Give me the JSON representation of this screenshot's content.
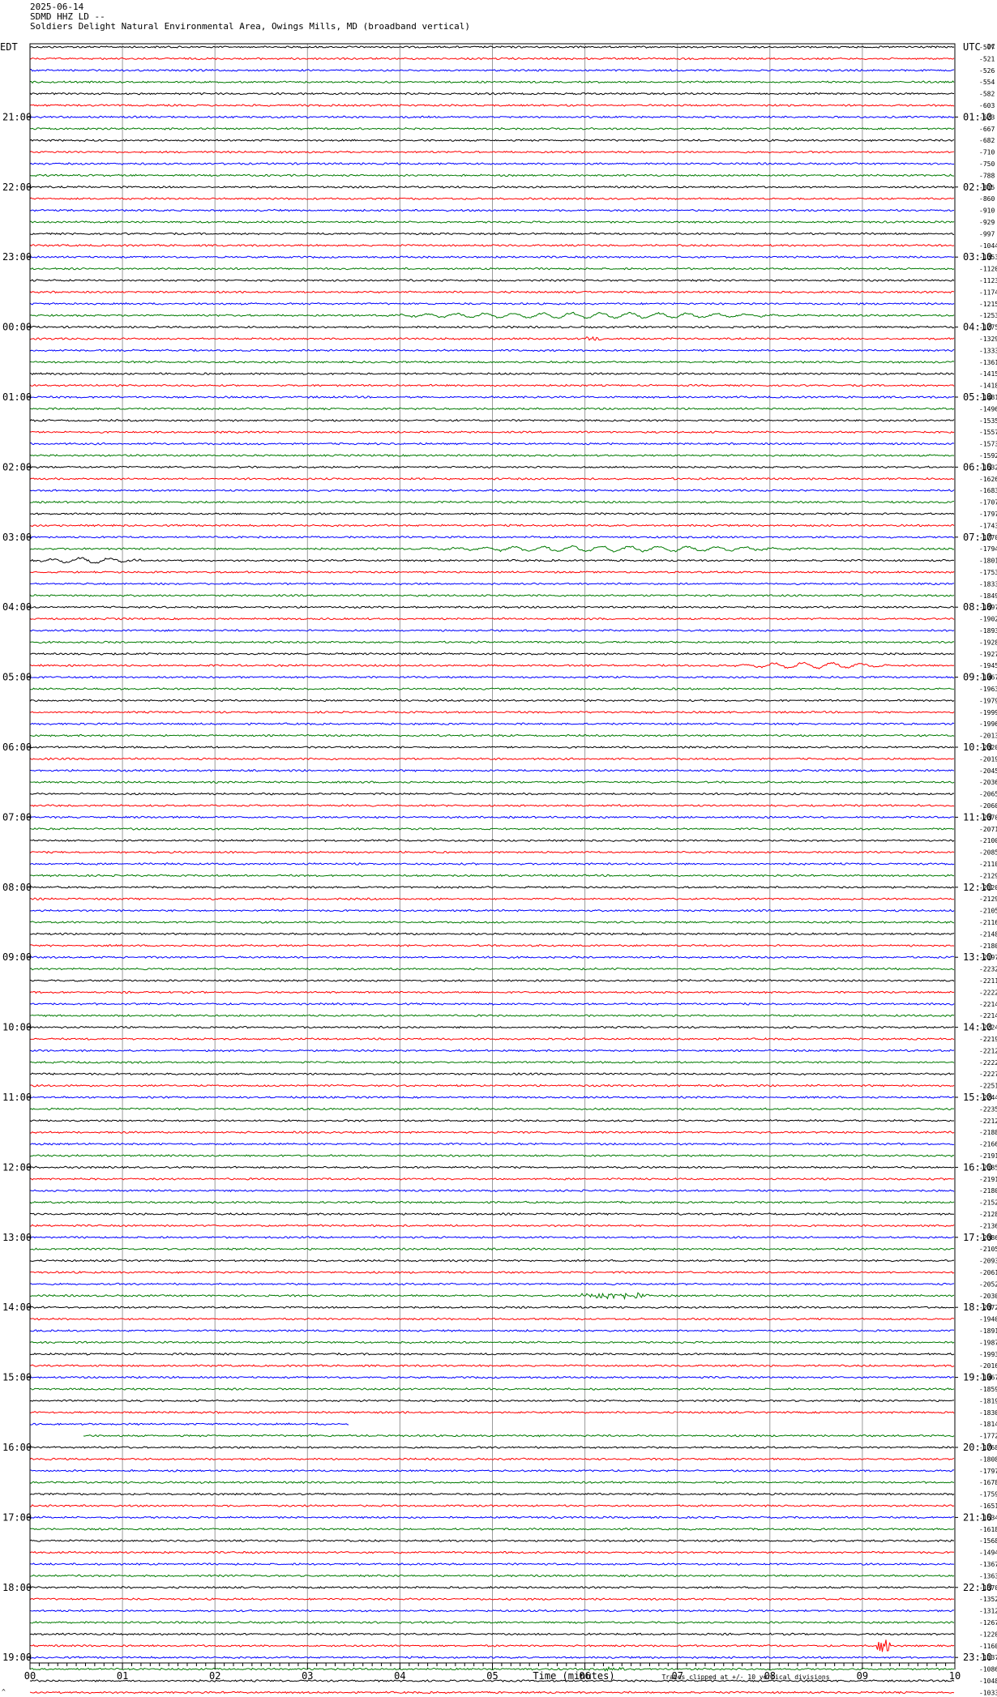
{
  "header": {
    "date": "2025-06-14",
    "station": "SDMD HHZ LD --",
    "location": "Soldiers Delight Natural Environmental Area, Owings Mills, MD (broadband vertical)"
  },
  "labels": {
    "left_tz": "EDT",
    "right_tz": "UTC",
    "dc": "DC",
    "footnote": "Traces clipped at +/- 10 vertical divisions",
    "corner": "^"
  },
  "chart_data": {
    "type": "line",
    "xlabel": "Time (minutes)",
    "x_ticks": [
      "00",
      "01",
      "02",
      "03",
      "04",
      "05",
      "06",
      "07",
      "08",
      "09",
      "10"
    ],
    "xlim": [
      0,
      10
    ],
    "grid": true,
    "trace_colors": [
      "#000000",
      "#ff0000",
      "#0000ff",
      "#007a00"
    ],
    "traces_per_hour": 6,
    "left_hour_labels": [
      "21:00",
      "22:00",
      "23:00",
      "00:00",
      "01:00",
      "02:00",
      "03:00",
      "04:00",
      "05:00",
      "06:00",
      "07:00",
      "08:00",
      "09:00",
      "10:00",
      "11:00",
      "12:00",
      "13:00",
      "14:00",
      "15:00",
      "16:00",
      "17:00",
      "18:00",
      "19:00"
    ],
    "right_hour_labels": [
      "01:10",
      "02:10",
      "03:10",
      "04:10",
      "05:10",
      "06:10",
      "07:10",
      "08:10",
      "09:10",
      "10:10",
      "11:10",
      "12:10",
      "13:10",
      "14:10",
      "15:10",
      "16:10",
      "17:10",
      "18:10",
      "19:10",
      "20:10",
      "21:10",
      "22:10",
      "23:10"
    ],
    "first_hour_label_row": 6,
    "dc_offsets": [
      "-507",
      "-521",
      "-526",
      "-554",
      "-582",
      "-603",
      "-623",
      "-667",
      "-682",
      "-710",
      "-750",
      "-788",
      "-815",
      "-860",
      "-910",
      "-929",
      "-997",
      "-1044",
      "-1053",
      "-1120",
      "-1123",
      "-1174",
      "-1215",
      "-1253",
      "-1275",
      "-1329",
      "-1333",
      "-1361",
      "-1415",
      "-1418",
      "-1481",
      "-1496",
      "-1535",
      "-1557",
      "-1573",
      "-1592",
      "-1632",
      "-1626",
      "-1683",
      "-1707",
      "-1797",
      "-1743",
      "-1770",
      "-1794",
      "-1801",
      "-1753",
      "-1833",
      "-1849",
      "-1897",
      "-1902",
      "-1893",
      "-1928",
      "-1927",
      "-1945",
      "-1967",
      "-1963",
      "-1979",
      "-1999",
      "-1996",
      "-2013",
      "-2020",
      "-2019",
      "-2045",
      "-2036",
      "-2065",
      "-2060",
      "-2070",
      "-2071",
      "-2100",
      "-2085",
      "-2110",
      "-2129",
      "-2120",
      "-2129",
      "-2105",
      "-2116",
      "-2148",
      "-2180",
      "-2197",
      "-2232",
      "-2211",
      "-2222",
      "-2214",
      "-2214",
      "-2224",
      "-2219",
      "-2212",
      "-2222",
      "-2227",
      "-2251",
      "-2244",
      "-2235",
      "-2212",
      "-2188",
      "-2166",
      "-2191",
      "-2185",
      "-2191",
      "-2180",
      "-2152",
      "-2128",
      "-2136",
      "-2086",
      "-2105",
      "-2093",
      "-2061",
      "-2052",
      "-2030",
      "-2072",
      "-1940",
      "-1891",
      "-1987",
      "-1993",
      "-2016",
      "-1967",
      "-1859",
      "-1819",
      "-1830",
      "-1814",
      "-1772",
      "-1768",
      "-1808",
      "-1797",
      "-1678",
      "-1759",
      "-1651",
      "-1634",
      "-1618",
      "-1568",
      "-1494",
      "-1367",
      "-1363",
      "-1370",
      "-1352",
      "-1312",
      "-1267",
      "-1220",
      "-1160",
      "-1137",
      "-1086",
      "-1048",
      "-1033",
      "-1029",
      "-1009"
    ],
    "events": [
      {
        "row": 23,
        "start_min": 3.5,
        "end_min": 10,
        "kind": "long-period swell"
      },
      {
        "row": 25,
        "start_min": 6.0,
        "end_min": 6.2,
        "kind": "small wiggle"
      },
      {
        "row": 43,
        "start_min": 4.0,
        "end_min": 10,
        "kind": "long-period swell"
      },
      {
        "row": 44,
        "start_min": 0,
        "end_min": 1.6,
        "kind": "long-period swell"
      },
      {
        "row": 53,
        "start_min": 7.5,
        "end_min": 10,
        "kind": "small swell"
      },
      {
        "row": 107,
        "start_min": 5.95,
        "end_min": 6.7,
        "kind": "local event"
      },
      {
        "row": 137,
        "start_min": 9.15,
        "end_min": 9.3,
        "kind": "spike"
      },
      {
        "row": 139,
        "start_min": 6.2,
        "end_min": 6.45,
        "kind": "small wiggle"
      }
    ],
    "gaps": [
      {
        "row": 118,
        "start_min": 3.45,
        "end_min": 10
      },
      {
        "row": 119,
        "start_min": 0,
        "end_min": 0.57
      }
    ]
  }
}
